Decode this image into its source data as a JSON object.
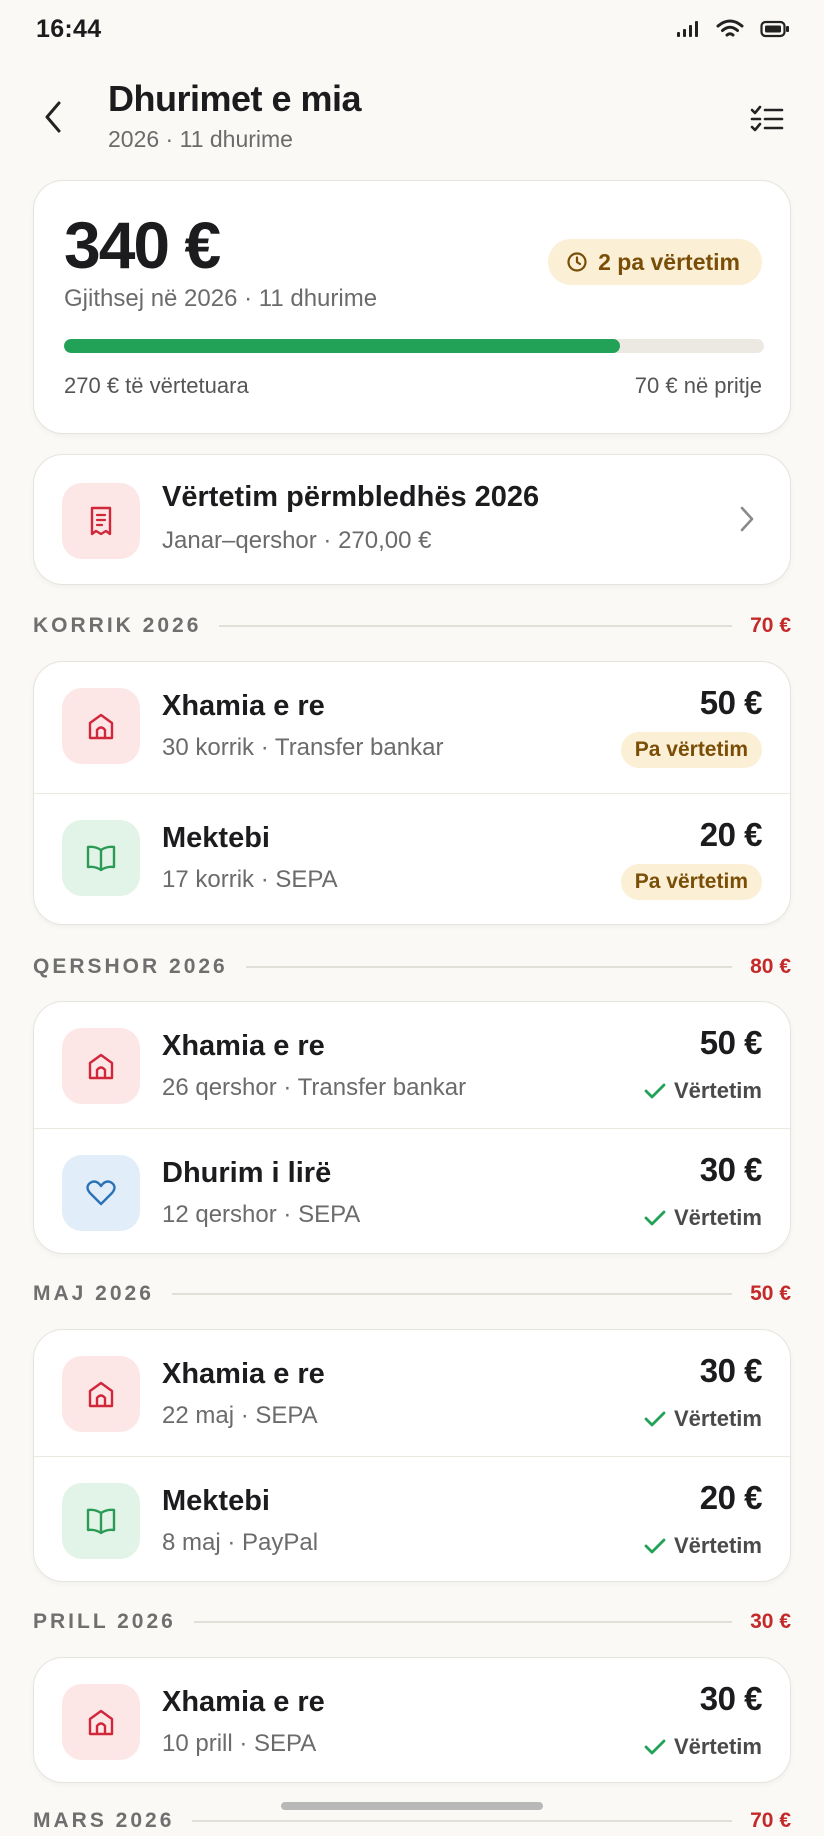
{
  "status_bar": {
    "time": "16:44"
  },
  "header": {
    "title": "Dhurimet e mia",
    "subtitle": "2026 · 11 dhurime"
  },
  "summary": {
    "total": "340 €",
    "caption": "Gjithsej në 2026 · 11 dhurime",
    "pending_badge": "2 pa vërtetim",
    "verified_text": "270 € të vërtetuara",
    "pending_text": "70 € në pritje",
    "verified_fraction": 0.794,
    "accent_green": "#22a257"
  },
  "receipt": {
    "title": "Vërtetim përmbledhës 2026",
    "subtitle": "Janar–qershor · 270,00 €",
    "icon": "receipt-icon"
  },
  "sections": [
    {
      "label": "KORRIK 2026",
      "total": "70 €",
      "rows": [
        {
          "title": "Xhamia e re",
          "sub": "30 korrik · Transfer bankar",
          "amount": "50 €",
          "status": "Pa vërtetim",
          "icon": "mosque-icon",
          "tone": "red",
          "verified": false
        },
        {
          "title": "Mektebi",
          "sub": "17 korrik · SEPA",
          "amount": "20 €",
          "status": "Pa vërtetim",
          "icon": "book-icon",
          "tone": "green",
          "verified": false
        }
      ]
    },
    {
      "label": "QERSHOR 2026",
      "total": "80 €",
      "rows": [
        {
          "title": "Xhamia e re",
          "sub": "26 qershor · Transfer bankar",
          "amount": "50 €",
          "status": "Vërtetim",
          "icon": "mosque-icon",
          "tone": "red",
          "verified": true
        },
        {
          "title": "Dhurim i lirë",
          "sub": "12 qershor · SEPA",
          "amount": "30 €",
          "status": "Vërtetim",
          "icon": "heart-icon",
          "tone": "blue",
          "verified": true
        }
      ]
    },
    {
      "label": "MAJ 2026",
      "total": "50 €",
      "rows": [
        {
          "title": "Xhamia e re",
          "sub": "22 maj · SEPA",
          "amount": "30 €",
          "status": "Vërtetim",
          "icon": "mosque-icon",
          "tone": "red",
          "verified": true
        },
        {
          "title": "Mektebi",
          "sub": "8 maj · PayPal",
          "amount": "20 €",
          "status": "Vërtetim",
          "icon": "book-icon",
          "tone": "green",
          "verified": true
        }
      ]
    },
    {
      "label": "PRILL 2026",
      "total": "30 €",
      "rows": [
        {
          "title": "Xhamia e re",
          "sub": "10 prill · SEPA",
          "amount": "30 €",
          "status": "Vërtetim",
          "icon": "mosque-icon",
          "tone": "red",
          "verified": true
        }
      ]
    },
    {
      "label": "MARS 2026",
      "total": "70 €",
      "rows": []
    }
  ]
}
